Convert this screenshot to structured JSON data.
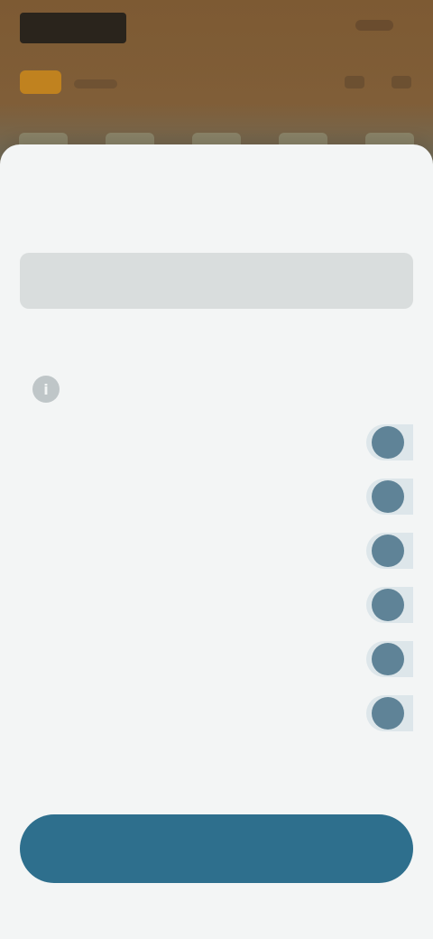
{
  "colors": {
    "header_bg": "#7d5a33",
    "accent_orange": "#c0821f",
    "sheet_bg": "#f3f5f5",
    "primary": "#2e6f8d",
    "radio": "#5f8397"
  },
  "header": {
    "logo_icon": "brand-logo",
    "menu_icons": [
      "notification-icon",
      "menu-icon"
    ]
  },
  "sheet": {
    "title": "",
    "search": {
      "placeholder": "",
      "value": ""
    },
    "sub_left": "",
    "sub_right": "",
    "section_label": "",
    "info_icon": "info-icon",
    "options": [
      {
        "label": ""
      },
      {
        "label": ""
      },
      {
        "label": ""
      },
      {
        "label": ""
      },
      {
        "label": ""
      },
      {
        "label": ""
      }
    ],
    "footer_note": "",
    "primary_button": ""
  }
}
